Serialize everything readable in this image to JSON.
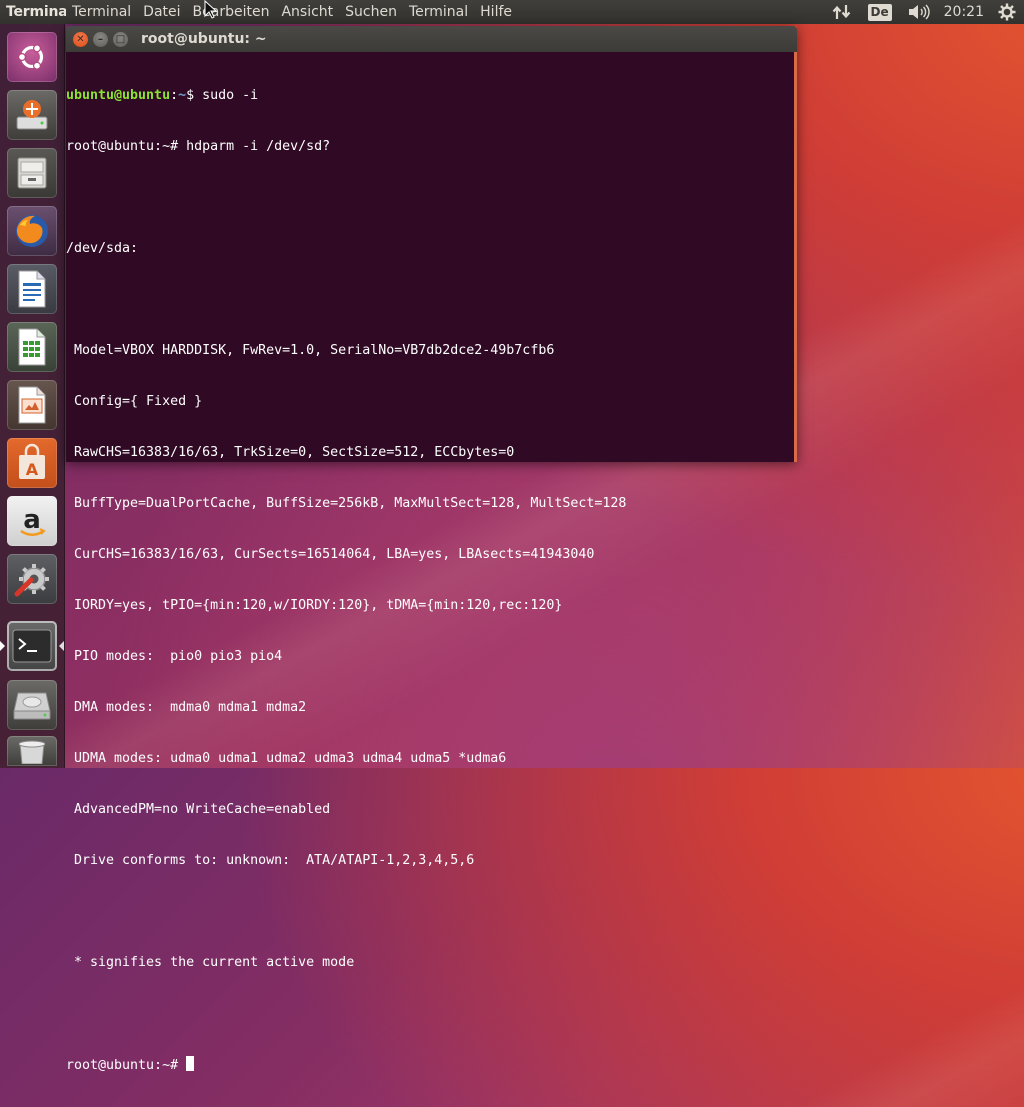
{
  "panel": {
    "app_title": "Terminal",
    "menu": [
      "Terminal",
      "Datei",
      "Bearbeiten",
      "Ansicht",
      "Suchen",
      "Terminal",
      "Hilfe"
    ],
    "keyboard_layout": "De",
    "clock": "20:21"
  },
  "launcher": {
    "items": [
      {
        "name": "ubuntu-dash",
        "icon": "ubuntu-logo-icon"
      },
      {
        "name": "installer",
        "icon": "install-ubuntu-icon"
      },
      {
        "name": "files",
        "icon": "file-cabinet-icon"
      },
      {
        "name": "firefox",
        "icon": "firefox-icon"
      },
      {
        "name": "libreoffice-writer",
        "icon": "writer-icon"
      },
      {
        "name": "libreoffice-calc",
        "icon": "calc-icon"
      },
      {
        "name": "libreoffice-impress",
        "icon": "impress-icon"
      },
      {
        "name": "software-center",
        "icon": "shopping-bag-icon"
      },
      {
        "name": "amazon",
        "icon": "amazon-icon"
      },
      {
        "name": "system-settings",
        "icon": "settings-wrench-icon"
      },
      {
        "name": "terminal",
        "icon": "terminal-icon"
      },
      {
        "name": "disk-drive",
        "icon": "hard-drive-icon"
      },
      {
        "name": "trash",
        "icon": "trash-icon"
      }
    ]
  },
  "window": {
    "title": "root@ubuntu: ~",
    "prompt1": {
      "host": "ubuntu@ubuntu",
      "path": "~",
      "symbol": "$",
      "command": " sudo -i"
    },
    "lines": [
      "root@ubuntu:~# hdparm -i /dev/sd?",
      "",
      "/dev/sda:",
      "",
      " Model=VBOX HARDDISK, FwRev=1.0, SerialNo=VB7db2dce2-49b7cfb6",
      " Config={ Fixed }",
      " RawCHS=16383/16/63, TrkSize=0, SectSize=512, ECCbytes=0",
      " BuffType=DualPortCache, BuffSize=256kB, MaxMultSect=128, MultSect=128",
      " CurCHS=16383/16/63, CurSects=16514064, LBA=yes, LBAsects=41943040",
      " IORDY=yes, tPIO={min:120,w/IORDY:120}, tDMA={min:120,rec:120}",
      " PIO modes:  pio0 pio3 pio4",
      " DMA modes:  mdma0 mdma1 mdma2",
      " UDMA modes: udma0 udma1 udma2 udma3 udma4 udma5 *udma6",
      " AdvancedPM=no WriteCache=enabled",
      " Drive conforms to: unknown:  ATA/ATAPI-1,2,3,4,5,6",
      "",
      " * signifies the current active mode",
      ""
    ],
    "final_prompt": "root@ubuntu:~# "
  }
}
